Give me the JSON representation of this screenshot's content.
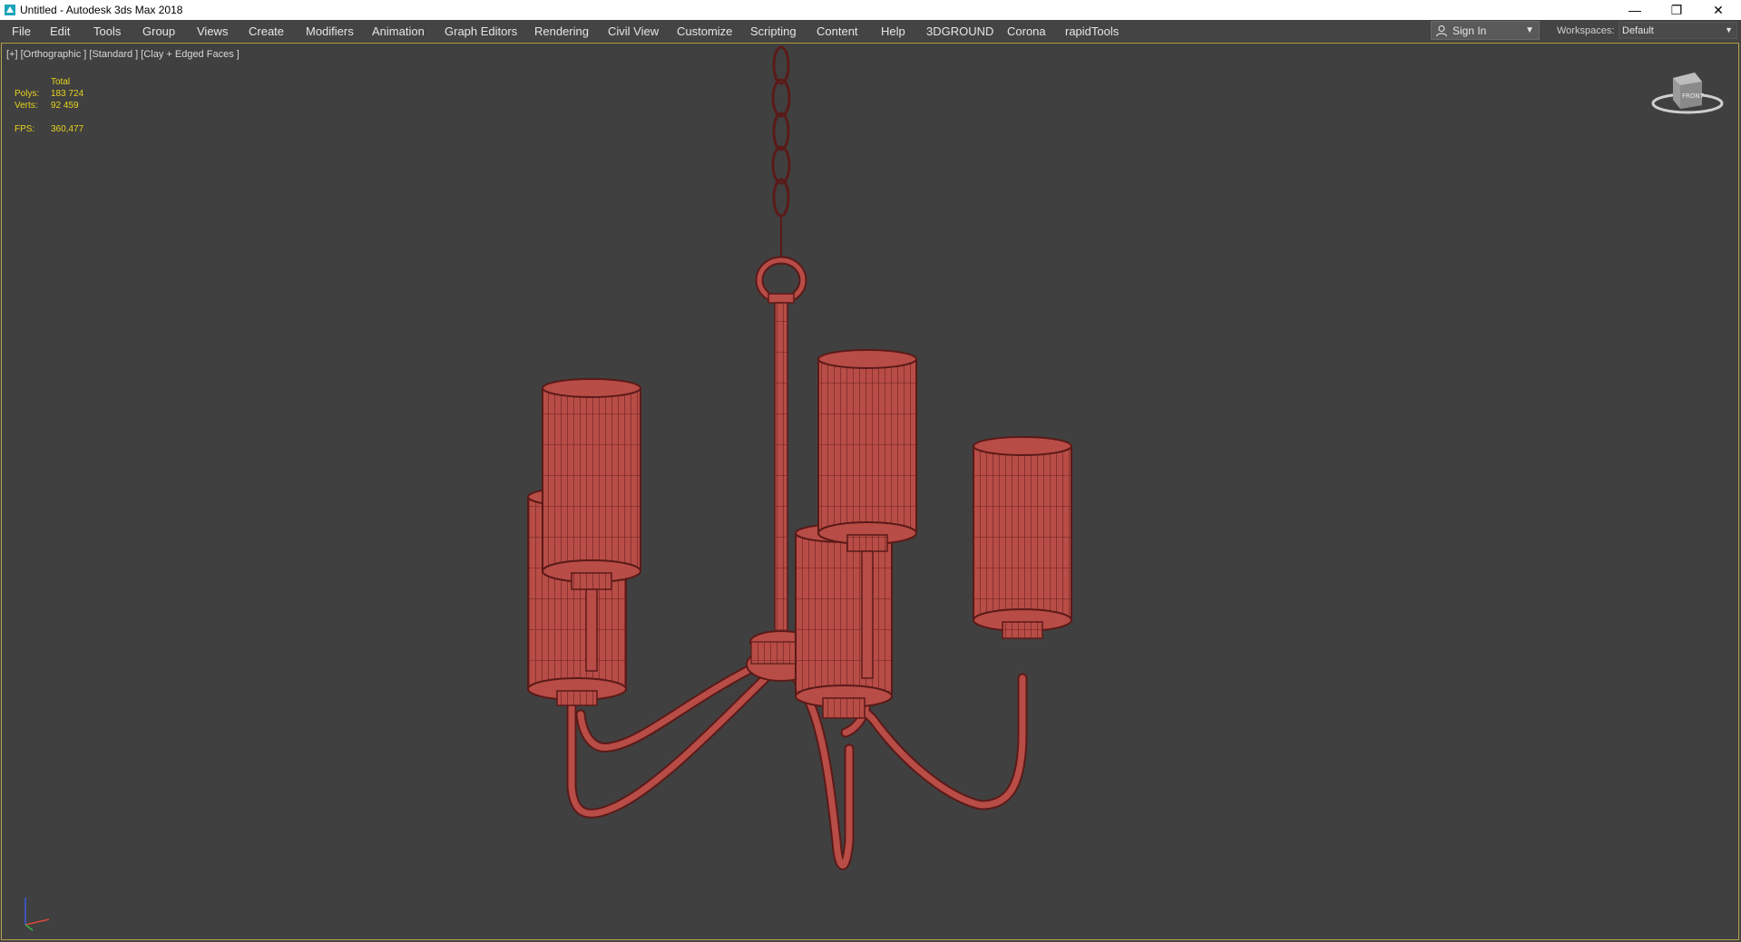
{
  "window": {
    "title": "Untitled - Autodesk 3ds Max 2018"
  },
  "window_controls": {
    "minimize": "—",
    "restore": "❐",
    "close": "✕"
  },
  "menu": [
    "File",
    "Edit",
    "Tools",
    "Group",
    "Views",
    "Create",
    "Modifiers",
    "Animation",
    "Graph Editors",
    "Rendering",
    "Civil View",
    "Customize",
    "Scripting",
    "Content",
    "Help",
    "3DGROUND",
    "Corona",
    "rapidTools"
  ],
  "account": {
    "signin_label": "Sign In"
  },
  "workspaces": {
    "label": "Workspaces:",
    "value": "Default"
  },
  "viewport": {
    "label": "[+] [Orthographic ] [Standard ] [Clay + Edged Faces ]",
    "stats": {
      "total_label": "Total",
      "polys_label": "Polys:",
      "polys_value": "183 724",
      "verts_label": "Verts:",
      "verts_value": "92 459",
      "fps_label": "FPS:",
      "fps_value": "360,477"
    },
    "viewcube_label": "FRONT"
  },
  "colors": {
    "viewport_bg": "#404040",
    "model": "#b84c46",
    "stats_text": "#e6d31e",
    "viewport_border": "#b3a24a"
  }
}
